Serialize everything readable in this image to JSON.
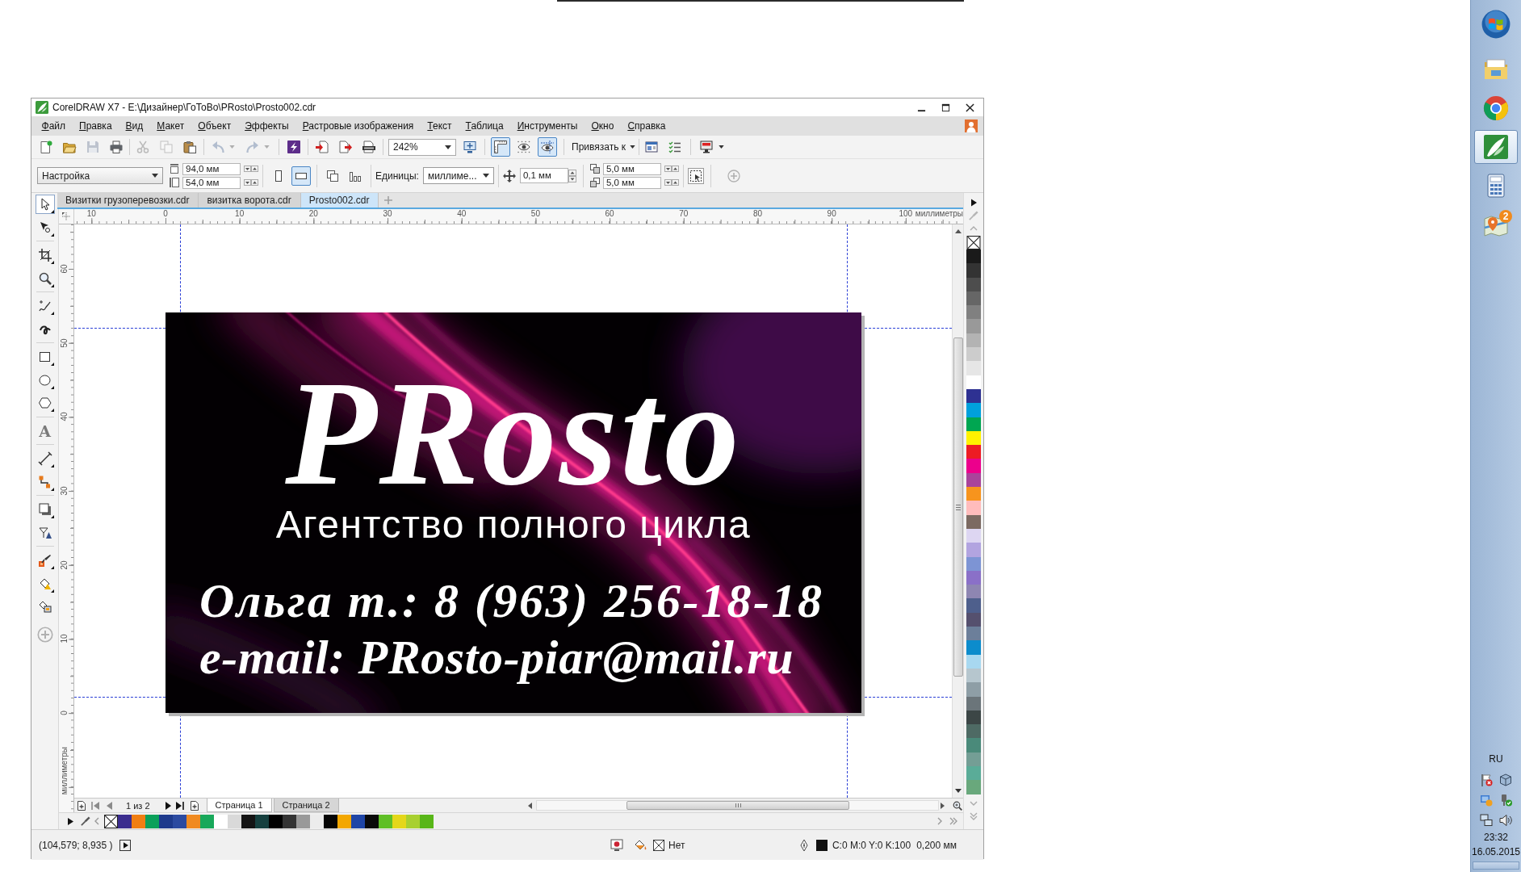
{
  "window": {
    "title": "CorelDRAW X7 - E:\\Дизайнер\\ГоТоВо\\PRosto\\Prosto002.cdr"
  },
  "menu": [
    "Файл",
    "Правка",
    "Вид",
    "Макет",
    "Объект",
    "Эффекты",
    "Растровые изображения",
    "Текст",
    "Таблица",
    "Инструменты",
    "Окно",
    "Справка"
  ],
  "standard_toolbar": {
    "groups": [
      [
        {
          "kind": "new",
          "disabled": false
        },
        {
          "kind": "open",
          "disabled": false
        },
        {
          "kind": "save",
          "disabled": true
        },
        {
          "kind": "print",
          "disabled": false
        }
      ],
      [
        {
          "kind": "cut",
          "disabled": true
        },
        {
          "kind": "copy",
          "disabled": true
        },
        {
          "kind": "paste",
          "disabled": false
        }
      ],
      [
        {
          "kind": "undo",
          "disabled": true
        },
        {
          "kind": "redo",
          "disabled": true
        }
      ],
      [
        {
          "kind": "connect",
          "disabled": false
        }
      ],
      [
        {
          "kind": "import",
          "disabled": false
        },
        {
          "kind": "export",
          "disabled": false
        },
        {
          "kind": "publish_pdf",
          "disabled": false
        }
      ],
      [
        {
          "kind": "zoom_combo",
          "value": "242%"
        },
        {
          "kind": "full_screen",
          "disabled": false
        }
      ],
      [
        {
          "kind": "rulers",
          "pressed": true
        },
        {
          "kind": "grid",
          "pressed": false
        },
        {
          "kind": "guidelines",
          "pressed": true
        }
      ],
      [
        {
          "kind": "snap_menu",
          "label": "Привязать к"
        }
      ],
      [
        {
          "kind": "options",
          "disabled": false
        },
        {
          "kind": "checklist",
          "disabled": false
        }
      ],
      [
        {
          "kind": "launch",
          "disabled": false
        }
      ]
    ]
  },
  "property_bar": {
    "preset": "Настройка",
    "page_width": "94,0 мм",
    "page_height": "54,0 мм",
    "orientation": [
      {
        "kind": "portrait",
        "selected": false
      },
      {
        "kind": "landscape",
        "selected": true
      }
    ],
    "units_label": "Единицы:",
    "units": "миллиме...",
    "nudge": "0,1 мм",
    "duplicate_horizontal": "5,0 мм",
    "duplicate_vertical": "5,0 мм"
  },
  "toolbox": [
    [
      {
        "kind": "pick",
        "selected": true
      },
      {
        "kind": "shape",
        "selected": false
      }
    ],
    [
      {
        "kind": "crop",
        "selected": false
      },
      {
        "kind": "zoom",
        "selected": false
      }
    ],
    [
      {
        "kind": "freehand",
        "selected": false
      },
      {
        "kind": "artistic",
        "selected": false
      }
    ],
    [
      {
        "kind": "rectangle",
        "selected": false
      },
      {
        "kind": "ellipse",
        "selected": false
      },
      {
        "kind": "polygon",
        "selected": false
      }
    ],
    [
      {
        "kind": "text",
        "glyph": "A",
        "selected": false
      }
    ],
    [
      {
        "kind": "dimension",
        "selected": false
      },
      {
        "kind": "connector",
        "selected": false
      }
    ],
    [
      {
        "kind": "shadow",
        "selected": false
      },
      {
        "kind": "transparency",
        "selected": false
      }
    ],
    [
      {
        "kind": "eyedropper",
        "selected": false
      },
      {
        "kind": "interactive_fill",
        "selected": false
      },
      {
        "kind": "smart_fill",
        "selected": false
      }
    ]
  ],
  "document_tabs": [
    {
      "label": "Визитки грузоперевозки.cdr",
      "selected": false
    },
    {
      "label": "визитка ворота.cdr",
      "selected": false
    },
    {
      "label": "Prosto002.cdr",
      "selected": true
    }
  ],
  "horizontal_ruler": {
    "labels": [
      "10",
      "0",
      "10",
      "20",
      "30",
      "40",
      "50",
      "60",
      "70",
      "80",
      "90",
      "100"
    ],
    "unit": "миллиметры"
  },
  "vertical_ruler": {
    "labels": [
      "60",
      "50",
      "40",
      "30",
      "20",
      "10",
      "0"
    ],
    "unit": "миллиметры"
  },
  "business_card": {
    "logo": "PRosto",
    "tagline": "Агентство полного цикла",
    "phone": "Ольга т.: 8 (963) 256-18-18",
    "email": "e-mail: PRosto-piar@mail.ru"
  },
  "page_navigator": {
    "counter": "1 из 2",
    "pages": [
      {
        "label": "Страница 1",
        "selected": true
      },
      {
        "label": "Страница 2",
        "selected": false
      }
    ]
  },
  "document_palette": [
    {
      "color": "#3b2d8e"
    },
    {
      "color": "#f07e12"
    },
    {
      "color": "#0aa05a"
    },
    {
      "color": "#1d3a8c"
    },
    {
      "color": "#2b4aa0"
    },
    {
      "color": "#f08a20"
    },
    {
      "color": "#18a85a"
    },
    {
      "color": "#ffffff"
    },
    {
      "color": "#d9d9d9"
    },
    {
      "color": "#141414"
    },
    {
      "color": "#16403f"
    },
    {
      "color": "#000000"
    },
    {
      "color": "#333333"
    },
    {
      "color": "#999999"
    },
    {
      "color": "#ececec"
    },
    {
      "color": "#050505"
    },
    {
      "color": "#f3a700"
    },
    {
      "color": "#1f45a6"
    },
    {
      "color": "#0a0a0a"
    },
    {
      "color": "#5fbf26"
    },
    {
      "color": "#e4d71a"
    },
    {
      "color": "#a8d030"
    },
    {
      "color": "#58b618"
    }
  ],
  "default_palette": [
    {
      "color": "#1a1a1a"
    },
    {
      "color": "#333333"
    },
    {
      "color": "#4d4d4d"
    },
    {
      "color": "#666666"
    },
    {
      "color": "#808080"
    },
    {
      "color": "#999999"
    },
    {
      "color": "#b3b3b3"
    },
    {
      "color": "#cccccc"
    },
    {
      "color": "#e6e6e6"
    },
    {
      "color": "#ffffff"
    },
    {
      "color": "#2e3192"
    },
    {
      "color": "#00a0dc"
    },
    {
      "color": "#00a651"
    },
    {
      "color": "#fff200"
    },
    {
      "color": "#ed1c24"
    },
    {
      "color": "#ec008c"
    },
    {
      "color": "#a9449b"
    },
    {
      "color": "#f7941d"
    },
    {
      "color": "#ffbcbc"
    },
    {
      "color": "#7c6a62"
    },
    {
      "color": "#ddd6f2"
    },
    {
      "color": "#b2a4e0"
    },
    {
      "color": "#7d94d4"
    },
    {
      "color": "#8a70c8"
    },
    {
      "color": "#8e86b2"
    },
    {
      "color": "#4e5f8c"
    },
    {
      "color": "#55506e"
    },
    {
      "color": "#6c7f9a"
    },
    {
      "color": "#0c8ccc"
    },
    {
      "color": "#a8d8f0"
    },
    {
      "color": "#b6c6ce"
    },
    {
      "color": "#8e9ea6"
    },
    {
      "color": "#6b757a"
    },
    {
      "color": "#3c4646"
    },
    {
      "color": "#4e6a64"
    },
    {
      "color": "#4a8a7a"
    },
    {
      "color": "#749e95"
    },
    {
      "color": "#5aac98"
    },
    {
      "color": "#69a87c"
    }
  ],
  "status_bar": {
    "cursor_position": "(104,579; 8,935 )",
    "fill": "Нет",
    "outline_color": "C:0 M:0 Y:0 K:100",
    "outline_width": "0,200 мм"
  },
  "taskbar": {
    "apps": [
      {
        "kind": "explorer",
        "active": false
      },
      {
        "kind": "browser",
        "active": false
      },
      {
        "kind": "vector_editor",
        "active": true
      },
      {
        "kind": "calculator",
        "active": false
      },
      {
        "kind": "maps",
        "active": false,
        "badge": "2"
      }
    ],
    "language": "RU",
    "time": "23:32",
    "date": "16.05.2015"
  }
}
